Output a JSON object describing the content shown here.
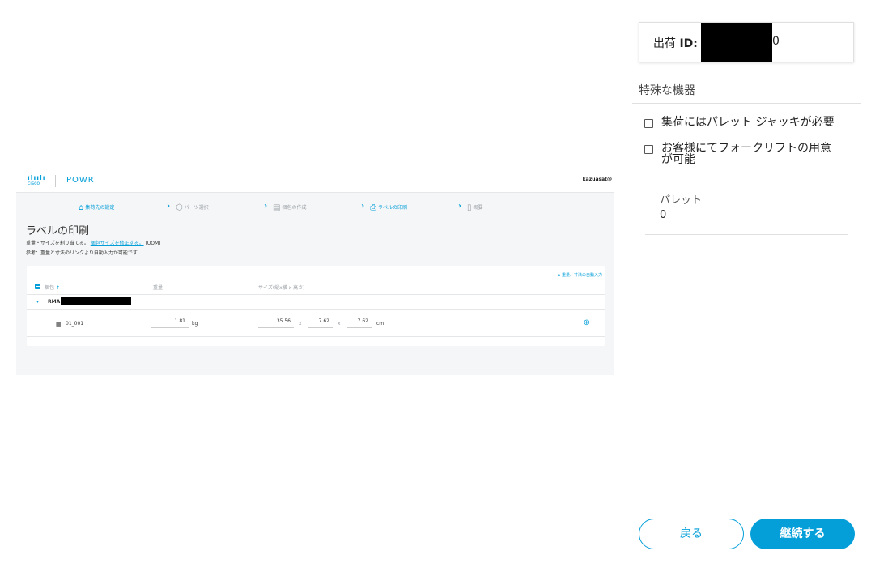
{
  "app": {
    "cisco_logo_text": "cisco",
    "product_name": "POWR",
    "user_name": "kazuasat@"
  },
  "stepper": {
    "steps": [
      {
        "label": "集荷先の設定",
        "icon": "location-icon",
        "state": "done"
      },
      {
        "label": "パーツ選択",
        "icon": "cube-icon",
        "state": "pending"
      },
      {
        "label": "梱包の作成",
        "icon": "package-icon",
        "state": "pending"
      },
      {
        "label": "ラベルの印刷",
        "icon": "print-label-icon",
        "state": "active"
      },
      {
        "label": "概要",
        "icon": "document-icon",
        "state": "pending"
      }
    ]
  },
  "main": {
    "title": "ラベルの印刷",
    "description_prefix": "重量・サイズを割り当てる。",
    "description_link": "梱包サイズを修正する。",
    "description_suffix": "(UOM)",
    "note": "参考：重量と寸法のリンクより自動入力が可能です",
    "auto_fill_link": "重量、寸法の自動入力",
    "table": {
      "headers": {
        "package": "梱包",
        "weight": "重量",
        "size": "サイズ(縦x横 x 高さ)"
      },
      "rma_label": "RMA:",
      "rows": [
        {
          "package_id": "01_001",
          "weight": "1.81",
          "weight_unit": "kg",
          "length": "35.56",
          "width": "7.62",
          "height": "7.62",
          "size_unit": "cm",
          "times": "x"
        }
      ]
    }
  },
  "panel": {
    "shipment_id_label": "出荷",
    "shipment_id_key": "ID:",
    "shipment_id_tail": "0",
    "special_equipment_title": "特殊な機器",
    "checkboxes": [
      {
        "label": "集荷にはパレット ジャッキが必要",
        "checked": false
      },
      {
        "label": "お客様にてフォークリフトの用意が可能",
        "checked": false
      }
    ],
    "pallet_label": "パレット",
    "pallet_value": "0",
    "back_button": "戻る",
    "continue_button": "継続する"
  },
  "colors": {
    "accent": "#049fd9",
    "text": "#333333",
    "redaction": "#000000"
  }
}
